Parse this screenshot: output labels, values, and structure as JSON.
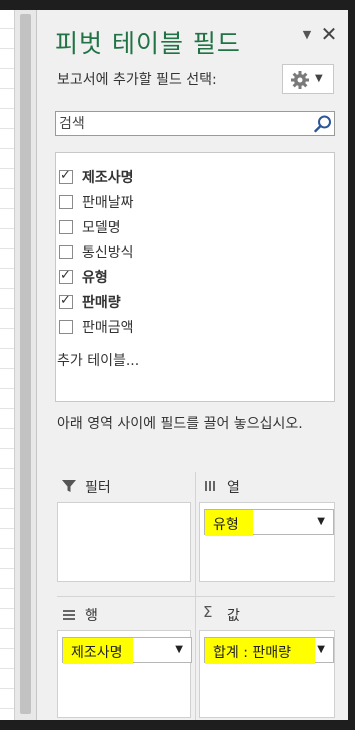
{
  "pane": {
    "title": "피벗 테이블 필드",
    "menu_icon": "dropdown-caret",
    "close_glyph": "✕",
    "choose_label": "보고서에 추가할 필드 선택:",
    "tools_icon": "gear-icon"
  },
  "search": {
    "placeholder": "검색",
    "value": ""
  },
  "fields": [
    {
      "label": "제조사명",
      "checked": true
    },
    {
      "label": "판매날짜",
      "checked": false
    },
    {
      "label": "모델명",
      "checked": false
    },
    {
      "label": "통신방식",
      "checked": false
    },
    {
      "label": "유형",
      "checked": true
    },
    {
      "label": "판매량",
      "checked": true
    },
    {
      "label": "판매금액",
      "checked": false
    }
  ],
  "more_tables": "추가 테이블...",
  "drag_hint": "아래 영역 사이에 필드를 끌어 놓으십시오.",
  "areas": {
    "filters": {
      "label": "필터",
      "icon": "filter-icon",
      "items": []
    },
    "columns": {
      "label": "열",
      "icon": "columns-icon",
      "items": [
        "유형"
      ]
    },
    "rows": {
      "label": "행",
      "icon": "rows-icon",
      "items": [
        "제조사명"
      ]
    },
    "values": {
      "label": "값",
      "icon": "sigma-icon",
      "items": [
        "합계 : 판매량"
      ]
    }
  },
  "highlight_color": "#ffff00",
  "accent_color": "#217346"
}
